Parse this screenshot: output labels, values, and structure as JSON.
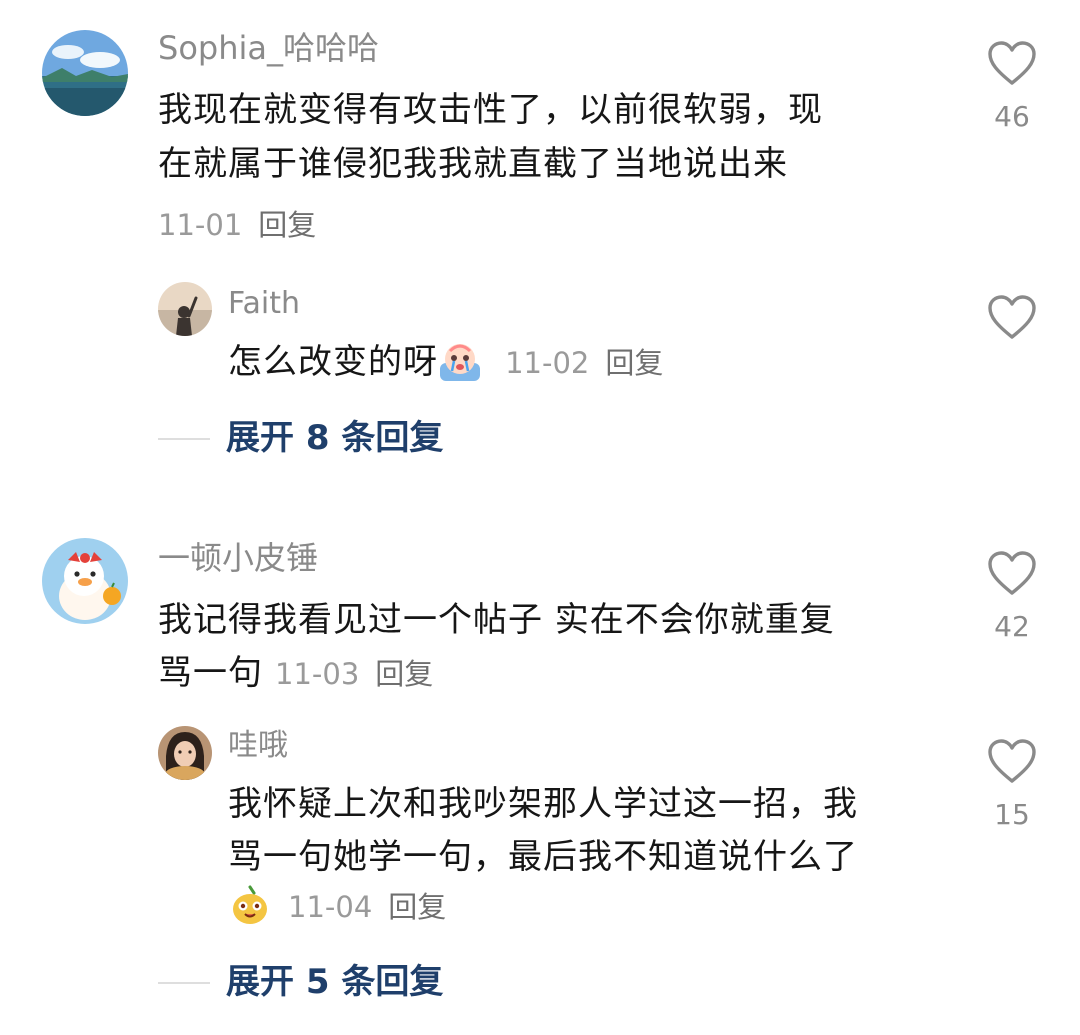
{
  "comments": [
    {
      "username": "Sophia_哈哈哈",
      "text_line1": "我现在就变得有攻击性了，以前很软弱，现",
      "text_line2": "在就属于谁侵犯我我就直截了当地说出来",
      "date": "11-01",
      "reply_label": "回复",
      "likes": "46",
      "avatar_icon": "avatar-ocean-landscape",
      "replies": [
        {
          "username": "Faith",
          "text": "怎么改变的呀",
          "emoji_icon": "crying-face-emoji",
          "date": "11-02",
          "reply_label": "回复",
          "avatar_icon": "avatar-person-at-sea"
        }
      ],
      "expand_label": "展开 8 条回复"
    },
    {
      "username": "一顿小皮锤",
      "text_line1": "我记得我看见过一个帖子 实在不会你就重复",
      "text_line2": "骂一句",
      "date": "11-03",
      "reply_label": "回复",
      "likes": "42",
      "avatar_icon": "avatar-cartoon-duck",
      "replies": [
        {
          "username": "哇哦",
          "text_line1": "我怀疑上次和我吵架那人学过这一招，我",
          "text_line2": "骂一句她学一句，最后我不知道说什么了",
          "emoji_icon": "smiling-fruit-emoji",
          "date": "11-04",
          "reply_label": "回复",
          "likes": "15",
          "avatar_icon": "avatar-girl-portrait"
        }
      ],
      "expand_label": "展开 5 条回复"
    }
  ],
  "colors": {
    "username": "#8a8a8a",
    "text": "#161616",
    "expand": "#1f3f6b",
    "heart": "#8a8a8a"
  }
}
